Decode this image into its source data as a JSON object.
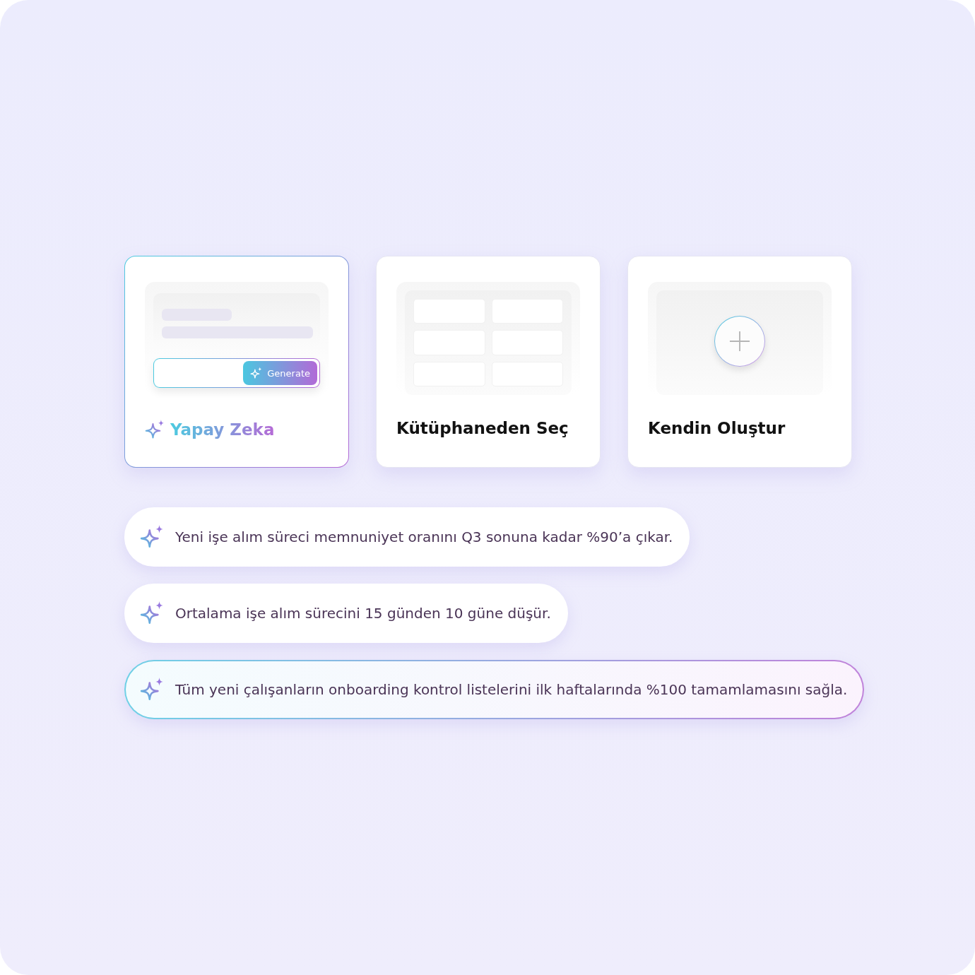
{
  "options": [
    {
      "kind": "ai",
      "title": "Yapay Zeka",
      "button": "Generate",
      "selected": true
    },
    {
      "kind": "library",
      "title": "Kütüphaneden Seç",
      "selected": false
    },
    {
      "kind": "custom",
      "title": "Kendin Oluştur",
      "selected": false
    }
  ],
  "suggestions": [
    {
      "text": "Yeni işe alım süreci memnuniyet oranını Q3 sonuna kadar %90’a çıkar.",
      "selected": false
    },
    {
      "text": "Ortalama işe alım sürecini 15 günden 10 güne düşür.",
      "selected": false
    },
    {
      "text": "Tüm yeni çalışanların onboarding kontrol listelerini ilk haftalarında %100 tamamlamasını sağla.",
      "selected": true
    }
  ]
}
